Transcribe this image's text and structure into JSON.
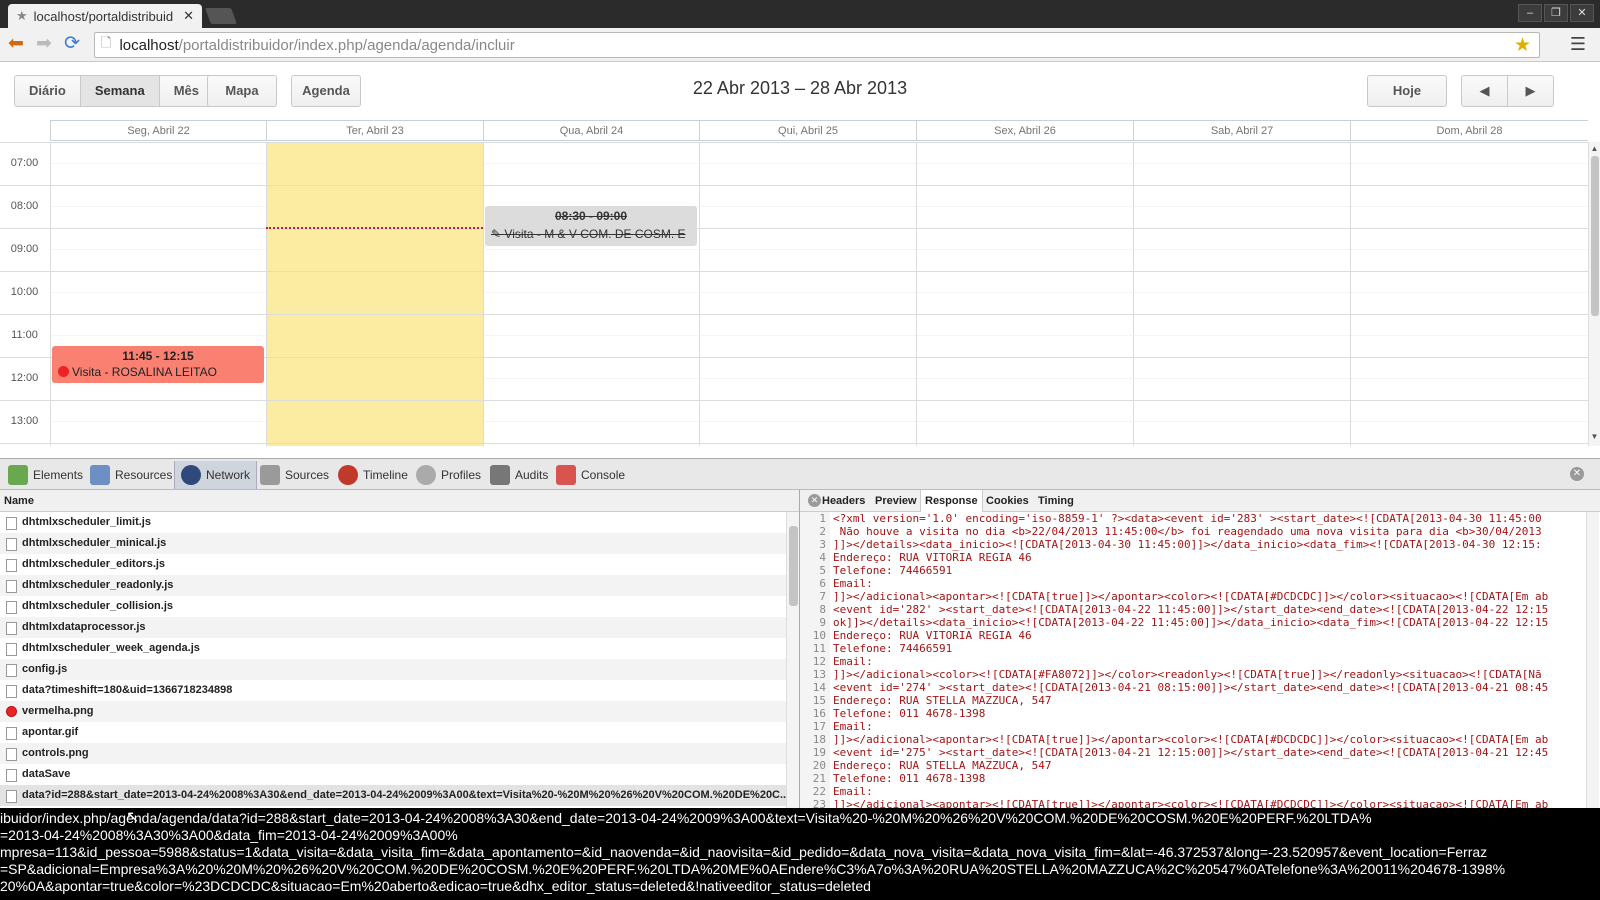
{
  "browser": {
    "tab_title": "localhost/portaldistribuid",
    "url_host": "localhost",
    "url_path": "/portaldistribuidor/index.php/agenda/agenda/incluir"
  },
  "scheduler": {
    "view_buttons": [
      "Diário",
      "Semana",
      "Mês"
    ],
    "active_view": "Semana",
    "map_button": "Mapa",
    "agenda_button": "Agenda",
    "date_range": "22 Abr 2013 – 28 Abr 2013",
    "today_button": "Hoje",
    "prev_icon": "◀",
    "next_icon": "▶",
    "days": [
      "Seg, Abril 22",
      "Ter, Abril 23",
      "Qua, Abril 24",
      "Qui, Abril 25",
      "Sex, Abril 26",
      "Sab, Abril 27",
      "Dom, Abril 28"
    ],
    "hours": [
      "07:00",
      "08:00",
      "09:00",
      "10:00",
      "11:00",
      "12:00",
      "13:00"
    ],
    "events": [
      {
        "time": "08:30 - 09:00",
        "text": "Visita - M & V COM. DE COSM. E",
        "color": "#DCDCDC",
        "status": "deleted"
      },
      {
        "time": "11:45 - 12:15",
        "text": "Visita - ROSALINA LEITAO",
        "color": "#FA8072",
        "status": "readonly"
      }
    ],
    "today_color": "#FBECA1"
  },
  "devtools": {
    "tabs": [
      "Elements",
      "Resources",
      "Network",
      "Sources",
      "Timeline",
      "Profiles",
      "Audits",
      "Console"
    ],
    "active_tab": "Network",
    "network": {
      "column": "Name",
      "files": [
        "dhtmlxscheduler_limit.js",
        "dhtmlxscheduler_minical.js",
        "dhtmlxscheduler_editors.js",
        "dhtmlxscheduler_readonly.js",
        "dhtmlxscheduler_collision.js",
        "dhtmlxdataprocessor.js",
        "dhtmlxscheduler_week_agenda.js",
        "config.js",
        "data?timeshift=180&uid=1366718234898",
        "vermelha.png",
        "apontar.gif",
        "controls.png",
        "dataSave",
        "data?id=288&start_date=2013-04-24%2008%3A30&end_date=2013-04-24%2009%3A00&text=Visita%20-%20M%20%26%20V%20COM.%20DE%20C..."
      ]
    },
    "response": {
      "tabs": [
        "Headers",
        "Preview",
        "Response",
        "Cookies",
        "Timing"
      ],
      "active_tab": "Response",
      "lines": [
        "<?xml version='1.0' encoding='iso-8859-1' ?><data><event id='283' ><start_date><![CDATA[2013-04-30 11:45:00",
        " Não houve a visita no dia <b>22/04/2013 11:45:00</b> foi reagendado uma nova visita para dia <b>30/04/2013",
        "]]></details><data_inicio><![CDATA[2013-04-30 11:45:00]]></data_inicio><data_fim><![CDATA[2013-04-30 12:15:",
        "Endereço: RUA VITORIA REGIA 46",
        "Telefone: 74466591",
        "Email:",
        "]]></adicional><apontar><![CDATA[true]]></apontar><color><![CDATA[#DCDCDC]]></color><situacao><![CDATA[Em ab",
        "<event id='282' ><start_date><![CDATA[2013-04-22 11:45:00]]></start_date><end_date><![CDATA[2013-04-22 12:15",
        "ok]]></details><data_inicio><![CDATA[2013-04-22 11:45:00]]></data_inicio><data_fim><![CDATA[2013-04-22 12:15",
        "Endereço: RUA VITORIA REGIA 46",
        "Telefone: 74466591",
        "Email:",
        "]]></adicional><color><![CDATA[#FA8072]]></color><readonly><![CDATA[true]]></readonly><situacao><![CDATA[Nã",
        "<event id='274' ><start_date><![CDATA[2013-04-21 08:15:00]]></start_date><end_date><![CDATA[2013-04-21 08:45",
        "Endereço: RUA STELLA MAZZUCA, 547",
        "Telefone: 011 4678-1398",
        "Email:",
        "]]></adicional><apontar><![CDATA[true]]></apontar><color><![CDATA[#DCDCDC]]></color><situacao><![CDATA[Em ab",
        "<event id='275' ><start_date><![CDATA[2013-04-21 12:15:00]]></start_date><end_date><![CDATA[2013-04-21 12:45",
        "Endereço: RUA STELLA MAZZUCA, 547",
        "Telefone: 011 4678-1398",
        "Email:",
        "]]></adicional><apontar><![CDATA[true]]></apontar><color><![CDATA[#DCDCDC]]></color><situacao><![CDATA[Em ab"
      ]
    }
  },
  "status_bar": "ibuidor/index.php/agenda/agenda/data?id=288&start_date=2013-04-24%2008%3A30&end_date=2013-04-24%2009%3A00&text=Visita%20-%20M%20%26%20V%20COM.%20DE%20COSM.%20E%20PERF.%20LTDA%\n=2013-04-24%2008%3A30%3A00&data_fim=2013-04-24%2009%3A00%\nmpresa=113&id_pessoa=5988&status=1&data_visita=&data_visita_fim=&data_apontamento=&id_naovenda=&id_naovisita=&id_pedido=&data_nova_visita=&data_nova_visita_fim=&lat=-46.372537&long=-23.520957&event_location=Ferraz\n=SP&adicional=Empresa%3A%20%20M%20%26%20V%20COM.%20DE%20COSM.%20E%20PERF.%20LTDA%20ME%0AEndere%C3%A7o%3A%20RUA%20STELLA%20MAZZUCA%2C%20547%0ATelefone%3A%20011%204678-1398%\n20%0A&apontar=true&color=%23DCDCDC&situacao=Em%20aberto&edicao=true&dhx_editor_status=deleted&!nativeeditor_status=deleted"
}
